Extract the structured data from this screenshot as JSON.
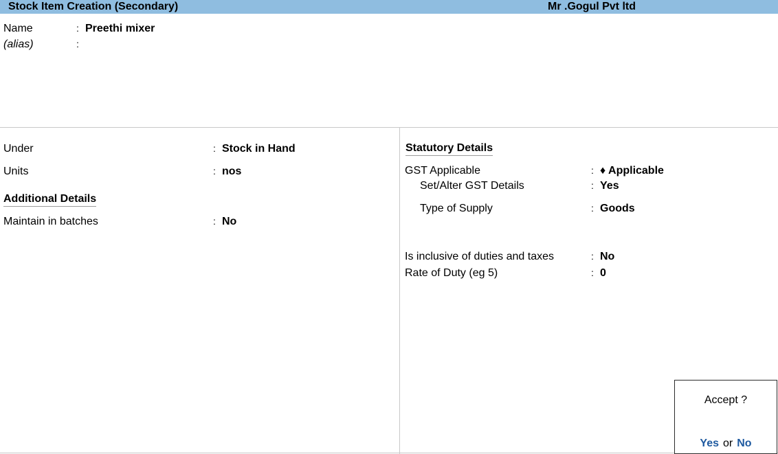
{
  "header": {
    "title": "Stock Item Creation (Secondary)",
    "company": "Mr .Gogul Pvt ltd"
  },
  "top": {
    "name_label": "Name",
    "name_value": "Preethi mixer",
    "alias_label": "(alias)",
    "alias_value": "",
    "colon": ":"
  },
  "left": {
    "under_label": "Under",
    "under_value": "Stock in Hand",
    "units_label": "Units",
    "units_value": "nos",
    "additional_heading": "Additional Details",
    "batches_label": "Maintain in batches",
    "batches_value": "No"
  },
  "right": {
    "statutory_heading": "Statutory Details",
    "gst_label": "GST Applicable",
    "gst_value": "♦ Applicable",
    "setalter_label": "Set/Alter GST Details",
    "setalter_value": "Yes",
    "supply_label": "Type of Supply",
    "supply_value": "Goods",
    "inclusive_label": "Is inclusive of duties and taxes",
    "inclusive_value": "No",
    "rate_label": "Rate of Duty (eg 5)",
    "rate_value": "0"
  },
  "dialog": {
    "question": "Accept ?",
    "yes": "Yes",
    "or": "or",
    "no": "No"
  }
}
